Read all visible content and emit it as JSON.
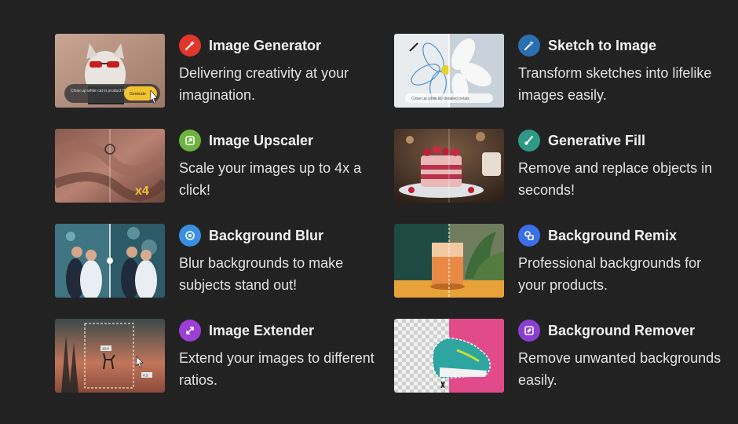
{
  "features": [
    {
      "title": "Image Generator",
      "desc": "Delivering creativity at your imagination.",
      "icon": "magic-wand-icon",
      "color": "#e0362b"
    },
    {
      "title": "Image Upscaler",
      "desc": "Scale your images up to 4x a click!",
      "icon": "expand-icon",
      "color": "#6db33f"
    },
    {
      "title": "Background Blur",
      "desc": "Blur backgrounds to make subjects stand out!",
      "icon": "blur-icon",
      "color": "#3a8fe0"
    },
    {
      "title": "Image Extender",
      "desc": "Extend your images to different ratios.",
      "icon": "arrows-diagonal-icon",
      "color": "#9b3fd6"
    },
    {
      "title": "Sketch to Image",
      "desc": "Transform sketches into lifelike images easily.",
      "icon": "pencil-sparkle-icon",
      "color": "#2a6fb0"
    },
    {
      "title": "Generative Fill",
      "desc": "Remove and replace objects in seconds!",
      "icon": "brush-icon",
      "color": "#2e9a86"
    },
    {
      "title": "Background Remix",
      "desc": "Professional backgrounds for your products.",
      "icon": "remix-icon",
      "color": "#3b6fe6"
    },
    {
      "title": "Background Remover",
      "desc": "Remove unwanted backgrounds easily.",
      "icon": "eraser-icon",
      "color": "#8a3fd0"
    }
  ],
  "thumb_text": {
    "generator_prompt": "Close up white cat in product Hi sunglasses",
    "generator_button": "Generate",
    "upscaler_label": "x4",
    "sketch_prompt": "Close up white lily detailed petals",
    "extender_tag_top": "16:9",
    "extender_tag_bottom": "4:3"
  }
}
